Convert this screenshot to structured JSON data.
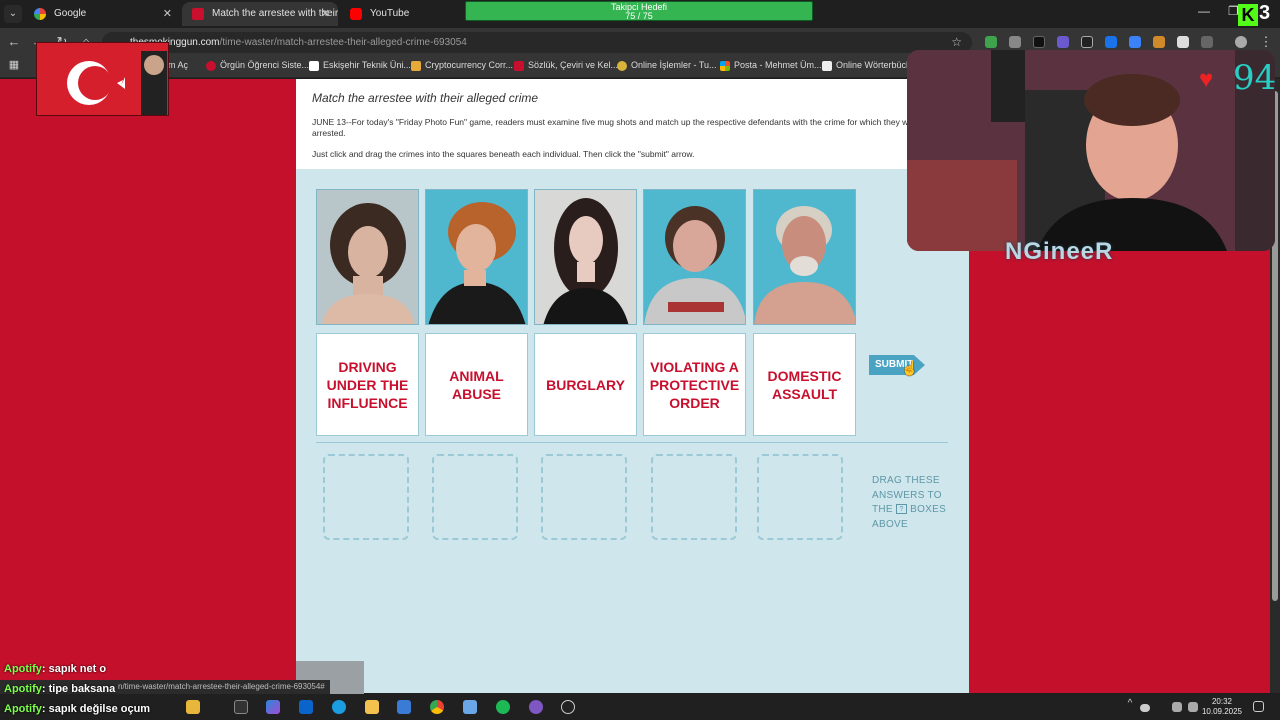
{
  "browser": {
    "tabs": [
      {
        "label": "Google",
        "active": false
      },
      {
        "label": "Match the arrestee with their a",
        "active": true
      },
      {
        "label": "YouTube",
        "active": false
      }
    ],
    "address": {
      "host": "thesmokinggun.com",
      "path": "/time-waster/match-arrestee-their-alleged-crime-693054"
    },
    "bookmarks": [
      "rum Aç",
      "Örgün Öğrenci Siste...",
      "Eskişehir Teknik Üni...",
      "Cryptocurrency Corr...",
      "Sözlük, Çeviri ve Kel...",
      "Online İşlemler - Tu...",
      "Posta - Mehmet Üm...",
      "Online Wörterbüche"
    ]
  },
  "goal": {
    "title": "Takipci Hedefi",
    "value": "75 / 75",
    "progress": 1.0
  },
  "article": {
    "title": "Match the arrestee with their alleged crime",
    "paragraph1": "JUNE 13--For today's \"Friday Photo Fun\" game, readers must examine five mug shots and match up the respective defendants with the crime for which they were arrested.",
    "paragraph2": "Just click and drag the crimes into the squares beneath each individual. Then click the \"submit\" arrow."
  },
  "game": {
    "crimes": [
      "DRIVING UNDER THE INFLUENCE",
      "ANIMAL ABUSE",
      "BURGLARY",
      "VIOLATING A PROTECTIVE ORDER",
      "DOMESTIC ASSAULT"
    ],
    "submit_label": "SUBMIT",
    "hint_line1": "DRAG THESE",
    "hint_line2": "ANSWERS TO",
    "hint_line3_a": "THE",
    "hint_qmark": "?",
    "hint_line3_b": "BOXES",
    "hint_line4": "ABOVE"
  },
  "overlay": {
    "streamer_name": "NGineeR",
    "hearts": "94"
  },
  "chat": [
    {
      "user": "Apotify",
      "message": ": sapık net o"
    },
    {
      "user": "Apotify",
      "message": ": tipe baksana"
    },
    {
      "user": "Apotify",
      "message": ": sapık değilse oçum"
    }
  ],
  "status_url": "n/time-waster/match-arrestee-their-alleged-crime-693054#",
  "taskbar": {
    "time": "20:32",
    "date": "10.09.2025"
  }
}
